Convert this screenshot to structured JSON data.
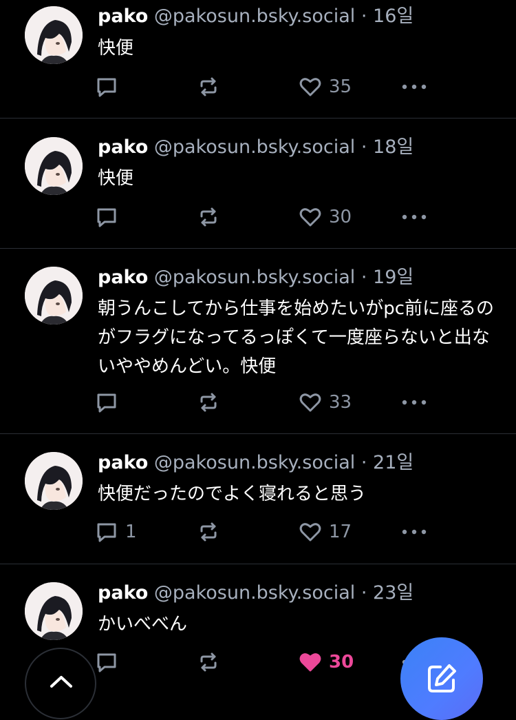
{
  "posts": [
    {
      "display_name": "pako",
      "handle": "@pakosun.bsky.social",
      "separator": "·",
      "time": "16일",
      "text": "快便",
      "replies": "",
      "likes": "35",
      "liked": false
    },
    {
      "display_name": "pako",
      "handle": "@pakosun.bsky.social",
      "separator": "·",
      "time": "18일",
      "text": "快便",
      "replies": "",
      "likes": "30",
      "liked": false
    },
    {
      "display_name": "pako",
      "handle": "@pakosun.bsky.social",
      "separator": "·",
      "time": "19일",
      "text": "朝うんこしてから仕事を始めたいがpc前に座るのがフラグになってるっぽくて一度座らないと出ないややめんどい。快便",
      "replies": "",
      "likes": "33",
      "liked": false
    },
    {
      "display_name": "pako",
      "handle": "@pakosun.bsky.social",
      "separator": "·",
      "time": "21일",
      "text": "快便だったのでよく寝れると思う",
      "replies": "1",
      "likes": "17",
      "liked": false
    },
    {
      "display_name": "pako",
      "handle": "@pakosun.bsky.social",
      "separator": "·",
      "time": "23일",
      "text": "かいべべん",
      "replies": "",
      "likes": "30",
      "liked": true
    }
  ],
  "colors": {
    "background": "#000000",
    "text": "#ffffff",
    "muted": "#a7b0be",
    "icon": "#8e97a5",
    "like_active": "#ec4899",
    "compose": "#4f7cff"
  },
  "icons": {
    "reply": "speech-bubble-icon",
    "repost": "repost-arrows-icon",
    "like": "heart-icon",
    "more": "ellipsis-icon",
    "scroll_top": "chevron-up-icon",
    "compose": "pencil-square-icon"
  }
}
